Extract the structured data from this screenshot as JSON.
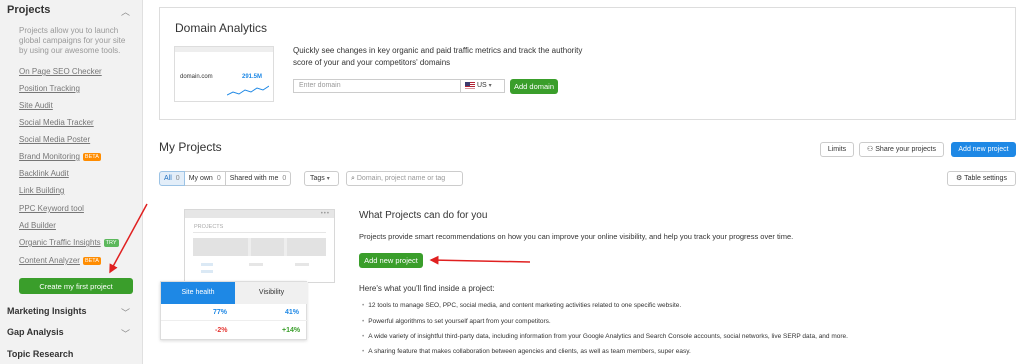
{
  "sidebar": {
    "title": "Projects",
    "description": "Projects allow you to launch global campaigns for your site by using our awesome tools.",
    "links": [
      {
        "label": "On Page SEO Checker"
      },
      {
        "label": "Position Tracking"
      },
      {
        "label": "Site Audit"
      },
      {
        "label": "Social Media Tracker"
      },
      {
        "label": "Social Media Poster"
      },
      {
        "label": "Brand Monitoring",
        "badge": "BETA"
      },
      {
        "label": "Backlink Audit"
      },
      {
        "label": "Link Building"
      },
      {
        "label": "PPC Keyword tool"
      },
      {
        "label": "Ad Builder"
      },
      {
        "label": "Organic Traffic Insights",
        "badge": "TRY"
      },
      {
        "label": "Content Analyzer",
        "badge": "BETA"
      }
    ],
    "create_button": "Create my first project",
    "sections": [
      "Marketing Insights",
      "Gap Analysis",
      "Topic Research"
    ]
  },
  "domain_analytics": {
    "title": "Domain Analytics",
    "preview_domain": "domain.com",
    "preview_value": "291.5M",
    "description": "Quickly see changes in key organic and paid traffic metrics and track the authority score of your and your competitors' domains",
    "input_placeholder": "Enter domain",
    "country": "US",
    "add_button": "Add domain"
  },
  "my_projects": {
    "title": "My Projects",
    "limits_button": "Limits",
    "share_button": "Share your projects",
    "add_button": "Add new project",
    "table_settings": "Table settings",
    "filters": [
      {
        "label": "All",
        "count": "0"
      },
      {
        "label": "My own",
        "count": "0"
      },
      {
        "label": "Shared with me",
        "count": "0"
      }
    ],
    "tags_label": "Tags",
    "search_placeholder": "Domain, project name or tag"
  },
  "promo": {
    "illustration_label": "PROJECTS",
    "table_headers": [
      "Site health",
      "Visibility"
    ],
    "rows": [
      {
        "site_health": "77%",
        "visibility": "41%"
      },
      {
        "site_health": "-2%",
        "visibility": "+14%"
      }
    ],
    "title": "What Projects can do for you",
    "text": "Projects provide smart recommendations on how you can improve your online visibility, and help you track your progress over time.",
    "add_button": "Add new project",
    "subtitle": "Here's what you'll find inside a project:",
    "bullets": [
      "12 tools to manage SEO, PPC, social media, and content marketing activities related to one specific website.",
      "Powerful algorithms to set yourself apart from your competitors.",
      "A wide variety of insightful third-party data, including information from your Google Analytics and Search Console accounts, social networks, live SERP data, and more.",
      "A sharing feature that makes collaboration between agencies and clients, as well as team members, super easy."
    ]
  },
  "colors": {
    "accent_blue": "#1e88e5",
    "accent_green": "#3a9e2b",
    "annotation_red": "#e02020"
  }
}
